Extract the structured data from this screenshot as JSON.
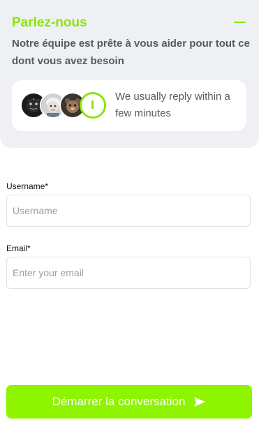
{
  "header": {
    "title": "Parlez-nous",
    "subtitle": "Notre équipe est prête à vous aider pour tout ce dont vous avez besoin",
    "collapse_icon": "minus-icon",
    "reply_card": {
      "text": "We usually reply within a few minutes",
      "avatars": [
        "agent-avatar-1",
        "agent-avatar-2",
        "agent-avatar-3"
      ],
      "status_icon": "clock-ring-icon"
    }
  },
  "form": {
    "username": {
      "label": "Username*",
      "placeholder": "Username",
      "value": ""
    },
    "email": {
      "label": "Email*",
      "placeholder": "Enter your email",
      "value": ""
    }
  },
  "cta": {
    "label": "Démarrer la conversation",
    "icon": "send-icon"
  },
  "colors": {
    "accent": "#8ce312",
    "button": "#8ef400",
    "header_bg": "#eef0f3",
    "muted_text": "#555a63"
  }
}
